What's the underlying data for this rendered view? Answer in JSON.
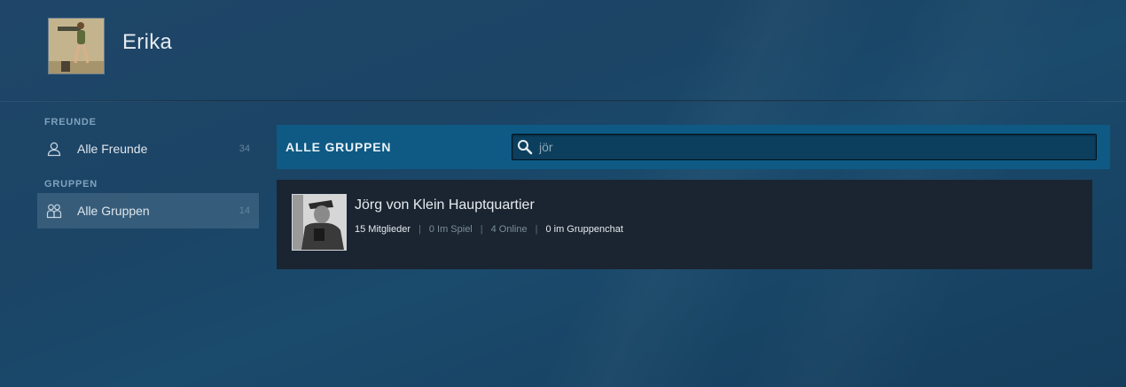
{
  "profile": {
    "username": "Erika",
    "avatar_icon": "user-avatar-image"
  },
  "sidebar": {
    "friends_section_label": "FREUNDE",
    "groups_section_label": "GRUPPEN",
    "items": [
      {
        "label": "Alle Freunde",
        "count": "34",
        "icon": "person-icon"
      },
      {
        "label": "Alle Gruppen",
        "count": "14",
        "icon": "group-icon",
        "active": true
      }
    ]
  },
  "main": {
    "title": "ALLE GRUPPEN",
    "search": {
      "value": "jör",
      "icon": "search-icon"
    },
    "groups": [
      {
        "name": "Jörg von Klein Hauptquartier",
        "members": "15 Mitglieder",
        "in_game": "0 Im Spiel",
        "online": "4 Online",
        "in_chat": "0 im Gruppenchat"
      }
    ]
  },
  "colors": {
    "background": "#1d4567",
    "header_bar": "#0e5a84",
    "row_background": "#1b2531",
    "active_item": "#3d6483"
  }
}
